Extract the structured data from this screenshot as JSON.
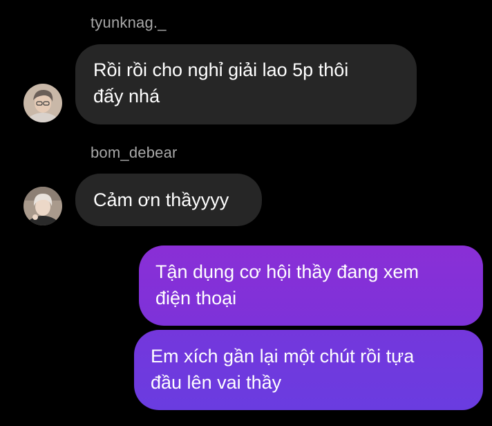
{
  "messages": [
    {
      "sender": "tyunknag._",
      "text": "Rồi rồi cho nghỉ giải lao 5p thôi\nđấy nhá",
      "avatar_icon": "user-avatar-icon"
    },
    {
      "sender": "bom_debear",
      "text": "Cảm ơn thầyyyy",
      "avatar_icon": "user-avatar-icon"
    },
    {
      "sender": "",
      "text": "Tận dụng cơ hội thầy đang xem\nđiện thoại"
    },
    {
      "sender": "",
      "text": "Em xích gần lại một chút rồi tựa\nđầu lên vai thầy"
    }
  ],
  "colors": {
    "background": "#000000",
    "incoming_bubble": "#262626",
    "outgoing_gradient_top": "#8a2fd6",
    "outgoing_gradient_bottom": "#6a3ce0",
    "sender_name": "#a8a8a8"
  }
}
